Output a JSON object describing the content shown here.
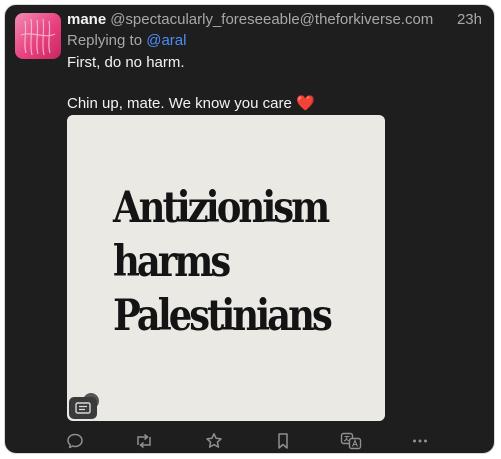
{
  "post": {
    "display_name": "mane",
    "handle": "@spectacularly_foreseeable@theforkiverse.com",
    "timestamp": "23h",
    "replying_prefix": "Replying to",
    "replying_mention": "@aral",
    "lines": [
      "First, do no harm.",
      "Chin up, mate. We know you care"
    ],
    "emoji": "❤️"
  },
  "media": {
    "text_lines": [
      "Antizionism",
      "harms",
      "Palestinians"
    ]
  },
  "actions": [
    {
      "icon": "reply-icon"
    },
    {
      "icon": "boost-icon"
    },
    {
      "icon": "favourite-icon"
    },
    {
      "icon": "bookmark-icon"
    },
    {
      "icon": "translate-icon"
    },
    {
      "icon": "more-icon"
    }
  ]
}
